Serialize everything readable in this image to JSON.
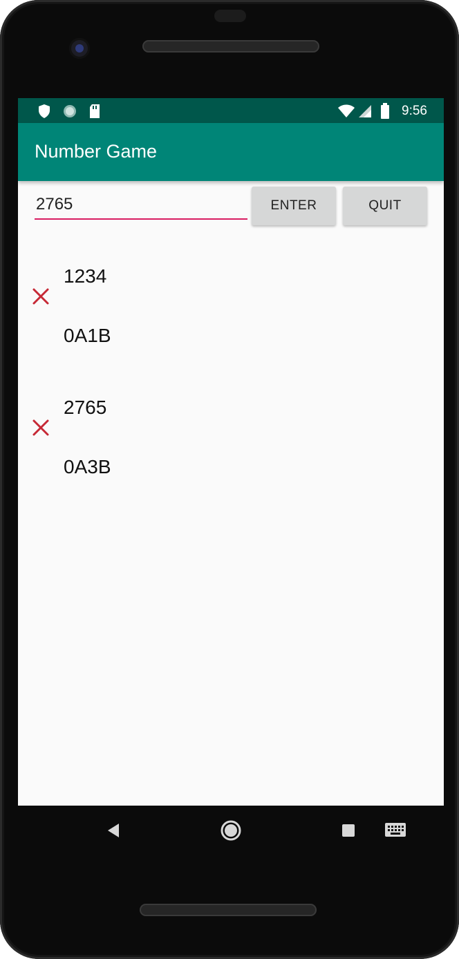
{
  "status_bar": {
    "time": "9:56",
    "left_icons": [
      "shield-icon",
      "sync-icon",
      "sd-card-icon"
    ],
    "right_icons": [
      "wifi-icon",
      "cell-signal-icon",
      "battery-icon"
    ]
  },
  "app_bar": {
    "title": "Number Game"
  },
  "input": {
    "value": "2765"
  },
  "buttons": {
    "enter_label": "ENTER",
    "quit_label": "QUIT"
  },
  "guesses": [
    {
      "number": "1234",
      "result": "0A1B",
      "status_icon": "close-icon"
    },
    {
      "number": "2765",
      "result": "0A3B",
      "status_icon": "close-icon"
    }
  ],
  "nav_bar": {
    "icons": [
      "back-icon",
      "home-icon",
      "recents-icon",
      "keyboard-icon"
    ]
  },
  "colors": {
    "status_bar": "#00574b",
    "app_bar": "#008577",
    "accent": "#d81b60",
    "error_icon": "#c62835"
  }
}
